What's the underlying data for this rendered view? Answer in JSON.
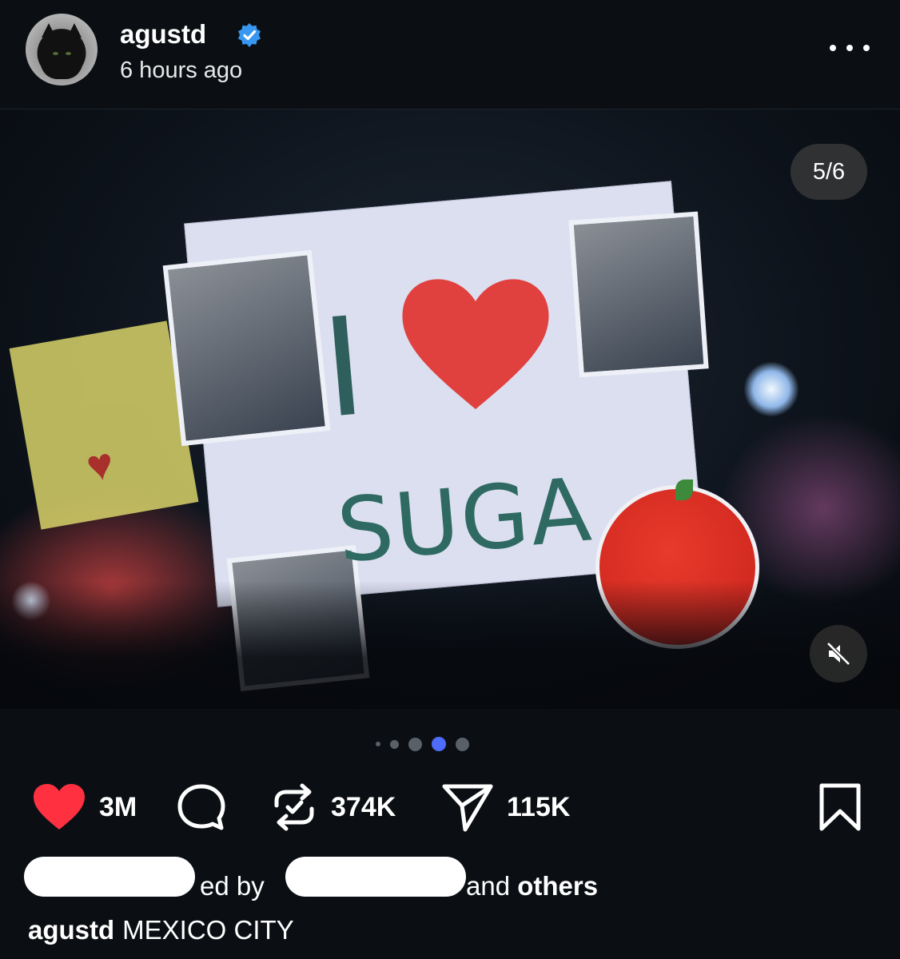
{
  "post": {
    "username": "agustd",
    "verified": true,
    "time_ago": "6 hours ago",
    "media_counter": "5/6",
    "carousel": {
      "total_dots": 5,
      "active_index": 3
    },
    "sign_text": {
      "line1": "I",
      "line2": "SUGA"
    }
  },
  "actions": {
    "likes": "3M",
    "reposts": "374K",
    "shares": "115K",
    "liked": true
  },
  "liked_by": {
    "partial_text": "ed by ",
    "and_text": "and ",
    "others_text": "others"
  },
  "caption": {
    "username": "agustd",
    "text": "MEXICO CITY"
  },
  "colors": {
    "background": "#0b0f14",
    "like_red": "#ff3040",
    "verified_blue": "#3897f0",
    "active_dot": "#4f6bfa"
  },
  "icons": [
    "more-icon",
    "verified-icon",
    "mute-icon",
    "heart-icon",
    "comment-icon",
    "repost-icon",
    "share-icon",
    "bookmark-icon"
  ]
}
